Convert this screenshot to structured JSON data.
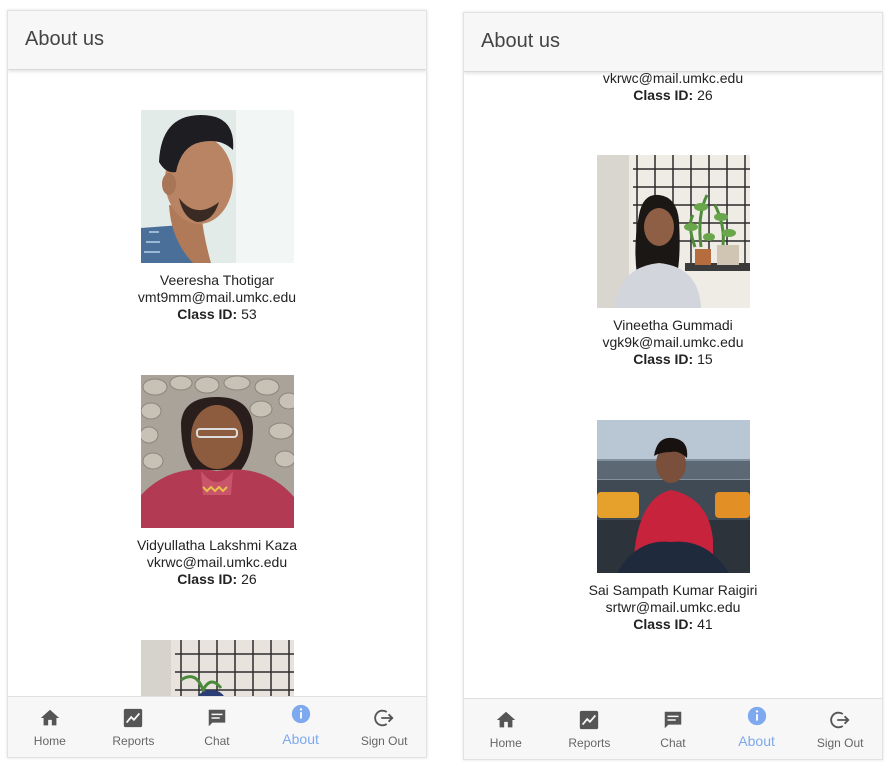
{
  "left": {
    "title": "About us",
    "members": [
      {
        "name": "Veeresha Thotigar",
        "email": "vmt9mm@mail.umkc.edu",
        "class_id_label": "Class ID:",
        "class_id": "53"
      },
      {
        "name": "Vidyullatha Lakshmi Kaza",
        "email": "vkrwc@mail.umkc.edu",
        "class_id_label": "Class ID:",
        "class_id": "26"
      }
    ]
  },
  "right": {
    "title": "About us",
    "members": [
      {
        "email": "vkrwc@mail.umkc.edu",
        "class_id_label": "Class ID:",
        "class_id": "26"
      },
      {
        "name": "Vineetha Gummadi",
        "email": "vgk9k@mail.umkc.edu",
        "class_id_label": "Class ID:",
        "class_id": "15"
      },
      {
        "name": "Sai Sampath Kumar Raigiri",
        "email": "srtwr@mail.umkc.edu",
        "class_id_label": "Class ID:",
        "class_id": "41"
      }
    ]
  },
  "tabs": [
    {
      "label": "Home",
      "icon": "home-icon"
    },
    {
      "label": "Reports",
      "icon": "chart-icon"
    },
    {
      "label": "Chat",
      "icon": "chat-icon"
    },
    {
      "label": "About",
      "icon": "info-icon",
      "active": true
    },
    {
      "label": "Sign Out",
      "icon": "sign-out-icon"
    }
  ],
  "colors": {
    "active_tab": "#7ea9ee",
    "inactive_tab": "#666666",
    "header_bg": "#f7f7f7"
  }
}
